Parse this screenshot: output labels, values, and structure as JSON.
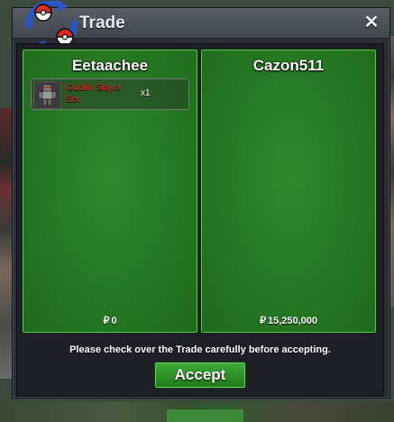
{
  "window": {
    "title": "Trade",
    "close_glyph": "✕",
    "logo_icon": "pokeball-trade-icon"
  },
  "left_panel": {
    "player_name": "Eetaachee",
    "items": [
      {
        "name": "Goblin Slayer Set",
        "quantity": "x1",
        "icon": "goblin-slayer-armor-icon"
      }
    ],
    "currency_symbol": "₽",
    "money": "0"
  },
  "right_panel": {
    "player_name": "Cazon511",
    "items": [],
    "currency_symbol": "₽",
    "money": "15,250,000"
  },
  "notice": "Please check over the Trade carefully before accepting.",
  "accept_label": "Accept",
  "colors": {
    "panel_green": "#267823",
    "item_name_red": "#e0241f",
    "button_green": "#2e9229"
  }
}
